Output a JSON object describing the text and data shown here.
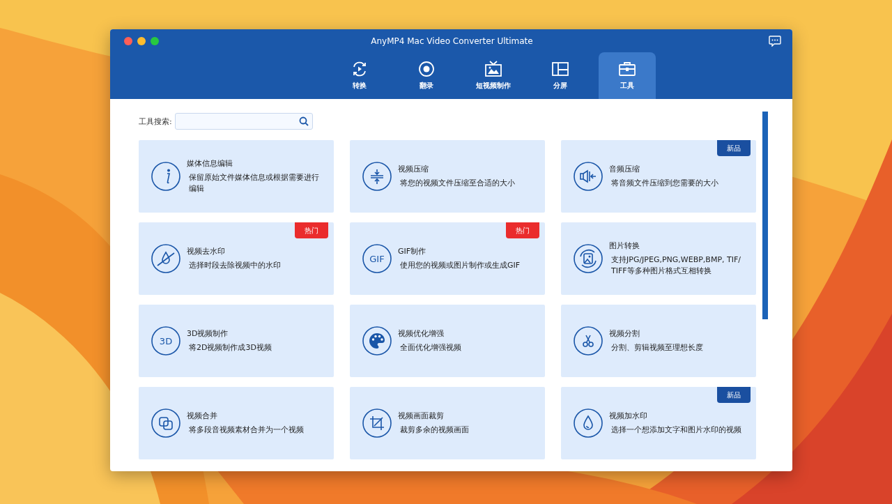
{
  "window": {
    "title": "AnyMP4 Mac Video Converter Ultimate"
  },
  "tabs": [
    {
      "label": "转换",
      "selected": false
    },
    {
      "label": "翻录",
      "selected": false
    },
    {
      "label": "短视频制作",
      "selected": false
    },
    {
      "label": "分屏",
      "selected": false
    },
    {
      "label": "工具",
      "selected": true
    }
  ],
  "search": {
    "label": "工具搜索:"
  },
  "tools": [
    {
      "title": "媒体信息编辑",
      "description": "保留原始文件媒体信息或根据需要进行编辑"
    },
    {
      "title": "视频压缩",
      "description": "将您的视频文件压缩至合适的大小"
    },
    {
      "title": "音频压缩",
      "description": "将音频文件压缩到您需要的大小",
      "badge": {
        "kind": "new",
        "text": "新品"
      }
    },
    {
      "title": "视频去水印",
      "description": "选择时段去除视频中的水印",
      "badge": {
        "kind": "hot",
        "text": "热门"
      }
    },
    {
      "title": "GIF制作",
      "icon_text": "GIF",
      "description": "使用您的视频或图片制作或生成GIF",
      "badge": {
        "kind": "hot",
        "text": "热门"
      }
    },
    {
      "title": "图片转换",
      "description": "支持JPG/JPEG,PNG,WEBP,BMP, TIF/ TIFF等多种图片格式互相转换"
    },
    {
      "title": "3D视频制作",
      "icon_text": "3D",
      "description": "将2D视频制作成3D视频"
    },
    {
      "title": "视频优化增强",
      "description": "全面优化增强视频"
    },
    {
      "title": "视频分割",
      "description": "分割、剪辑视频至理想长度"
    },
    {
      "title": "视频合并",
      "description": "将多段音视频素材合并为一个视频"
    },
    {
      "title": "视频画面裁剪",
      "description": "裁剪多余的视频画面"
    },
    {
      "title": "视频加水印",
      "description": "选择一个想添加文字和图片水印的视频",
      "badge": {
        "kind": "new",
        "text": "新品"
      }
    }
  ]
}
